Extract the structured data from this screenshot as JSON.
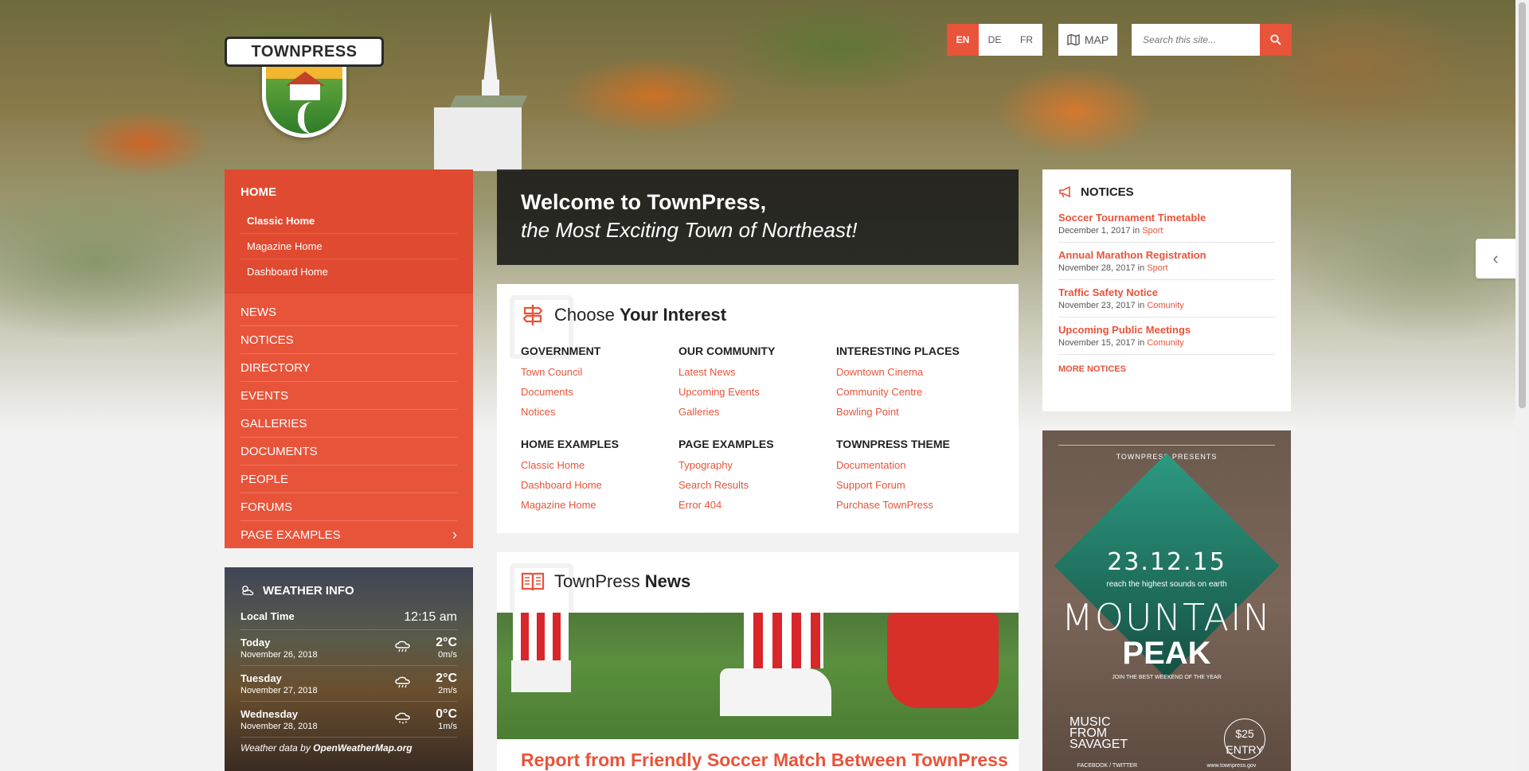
{
  "brand": {
    "logo_text": "TOWNPRESS"
  },
  "topbar": {
    "languages": [
      {
        "code": "EN",
        "active": true
      },
      {
        "code": "DE",
        "active": false
      },
      {
        "code": "FR",
        "active": false
      }
    ],
    "map_label": "MAP",
    "search_placeholder": "Search this site..."
  },
  "nav": {
    "home_label": "HOME",
    "home_sub": [
      "Classic Home",
      "Magazine Home",
      "Dashboard Home"
    ],
    "items": [
      "NEWS",
      "NOTICES",
      "DIRECTORY",
      "EVENTS",
      "GALLERIES",
      "DOCUMENTS",
      "PEOPLE",
      "FORUMS",
      "PAGE EXAMPLES"
    ],
    "expand_icon": "chevron-right-icon"
  },
  "weather": {
    "title": "WEATHER INFO",
    "local_time_label": "Local Time",
    "local_time": "12:15 am",
    "days": [
      {
        "day": "Today",
        "date": "November 26, 2018",
        "temp": "2°C",
        "wind": "0m/s"
      },
      {
        "day": "Tuesday",
        "date": "November 27, 2018",
        "temp": "2°C",
        "wind": "2m/s"
      },
      {
        "day": "Wednesday",
        "date": "November 28, 2018",
        "temp": "0°C",
        "wind": "1m/s"
      }
    ],
    "credit_prefix": "Weather data by ",
    "credit_source": "OpenWeatherMap.org"
  },
  "welcome": {
    "line1": "Welcome to TownPress,",
    "line2": "the Most Exciting Town of Northeast!"
  },
  "interest": {
    "title_light": "Choose ",
    "title_bold": "Your Interest",
    "columns": [
      {
        "heading": "GOVERNMENT",
        "links": [
          "Town Council",
          "Documents",
          "Notices"
        ]
      },
      {
        "heading": "OUR COMMUNITY",
        "links": [
          "Latest News",
          "Upcoming Events",
          "Galleries"
        ]
      },
      {
        "heading": "INTERESTING PLACES",
        "links": [
          "Downtown Cinema",
          "Community Centre",
          "Bowling Point"
        ]
      },
      {
        "heading": "HOME EXAMPLES",
        "links": [
          "Classic Home",
          "Dashboard Home",
          "Magazine Home"
        ]
      },
      {
        "heading": "PAGE EXAMPLES",
        "links": [
          "Typography",
          "Search Results",
          "Error 404"
        ]
      },
      {
        "heading": "TOWNPRESS THEME",
        "links": [
          "Documentation",
          "Support Forum",
          "Purchase TownPress"
        ]
      }
    ]
  },
  "news": {
    "title_light": "TownPress ",
    "title_bold": "News",
    "headline": "Report from Friendly Soccer Match Between TownPress"
  },
  "notices": {
    "title": "NOTICES",
    "items": [
      {
        "title": "Soccer Tournament Timetable",
        "date": "December 1, 2017",
        "in": " in ",
        "category": "Sport"
      },
      {
        "title": "Annual Marathon Registration",
        "date": "November 28, 2017",
        "in": " in ",
        "category": "Sport"
      },
      {
        "title": "Traffic Safety Notice",
        "date": "November 23, 2017",
        "in": " in ",
        "category": "Comunity"
      },
      {
        "title": "Upcoming Public Meetings",
        "date": "November 15, 2017",
        "in": " in ",
        "category": "Comunity"
      }
    ],
    "more_label": "MORE NOTICES"
  },
  "poster": {
    "presents": "TOWNPRESS PRESENTS",
    "date": "23.12.15",
    "reach": "reach the highest sounds on earth",
    "title1": "MOUNTAIN",
    "title2": "PEAK",
    "join": "JOIN THE BEST WEEKEND OF THE YEAR",
    "music": "MUSIC FROM SAVAGET",
    "entry": "$25 ENTRY",
    "social": "FACEBOOK / TWITTER",
    "site": "www.townpress.gov"
  },
  "colors": {
    "accent": "#e8543a",
    "dark": "#141414"
  }
}
